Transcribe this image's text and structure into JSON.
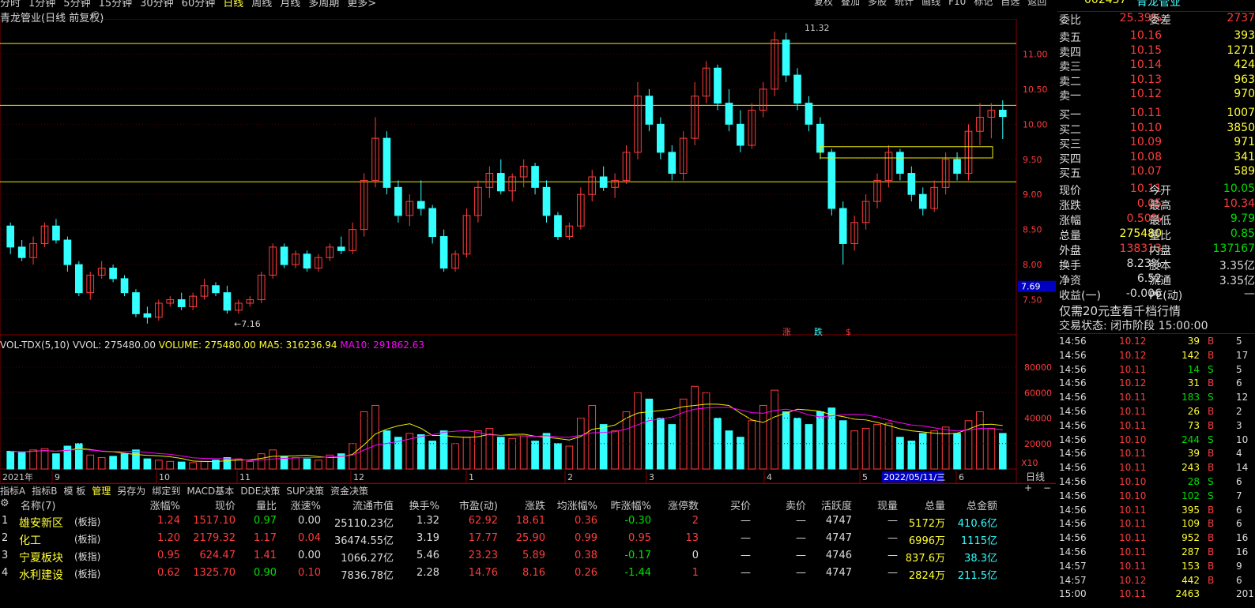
{
  "toolbar": {
    "periods": [
      "分时",
      "1分钟",
      "5分钟",
      "15分钟",
      "30分钟",
      "60分钟",
      "日线",
      "周线",
      "月线",
      "多周期",
      "更多>"
    ],
    "right": [
      "复权",
      "叠加",
      "多股",
      "统计",
      "画线",
      "F10",
      "标记",
      "自选",
      "返回"
    ]
  },
  "chart_title": "青龙管业(日线 前复权)",
  "stock_header": {
    "code": "002457",
    "name": "青龙管业"
  },
  "price_axis": {
    "ticks": [
      "11.00",
      "10.50",
      "10.00",
      "9.50",
      "9.00",
      "8.50",
      "8.00",
      "7.50"
    ],
    "last_label": "7.69"
  },
  "annotations": {
    "high": "11.32",
    "low": "7.16",
    "signals": [
      "涨",
      "跌",
      "$"
    ]
  },
  "volume_legend": {
    "name": "VOL-TDX(5,10)",
    "vvol": "VVOL: 275480.00",
    "volume": "VOLUME: 275480.00",
    "ma5": "MA5: 316236.94",
    "ma10": "MA10: 291862.63"
  },
  "volume_axis": {
    "ticks": [
      "80000",
      "60000",
      "40000",
      "20000"
    ],
    "unit": "X10"
  },
  "date_axis": {
    "labels": [
      "2021年",
      "9",
      "10",
      "11",
      "12",
      "1",
      "2",
      "3",
      "4",
      "5",
      "6"
    ],
    "cursor_date": "2022/05/11/三",
    "mode": "日线"
  },
  "bottom_tabs": [
    "指标A",
    "指标B",
    "模 板",
    "管理",
    "另存为",
    "绑定到",
    "MACD基本",
    "DDE决策",
    "SUP决策",
    "资金决策"
  ],
  "table": {
    "title": "名称(7)",
    "headers": [
      "涨幅%",
      "现价",
      "量比",
      "涨速%",
      "流通市值",
      "换手%",
      "市盈(动)",
      "涨跌",
      "均涨幅%",
      "昨涨幅%",
      "涨停数",
      "买价",
      "卖价",
      "活跃度",
      "现量",
      "总量",
      "总金额"
    ],
    "rows": [
      {
        "n": "1",
        "name": "雄安新区",
        "tag": "(板指)",
        "v": [
          "1.24",
          "1517.10",
          "0.97",
          "0.00",
          "25110.23亿",
          "1.32",
          "62.92",
          "18.61",
          "0.36",
          "-0.30",
          "2",
          "—",
          "—",
          "4747",
          "—",
          "5172万",
          "410.6亿"
        ]
      },
      {
        "n": "2",
        "name": "化工",
        "tag": "(板指)",
        "v": [
          "1.20",
          "2179.32",
          "1.17",
          "0.04",
          "36474.55亿",
          "3.19",
          "17.77",
          "25.90",
          "0.99",
          "0.95",
          "13",
          "—",
          "—",
          "4747",
          "—",
          "6996万",
          "1115亿"
        ]
      },
      {
        "n": "3",
        "name": "宁夏板块",
        "tag": "(板指)",
        "v": [
          "0.95",
          "624.47",
          "1.41",
          "0.00",
          "1066.27亿",
          "5.46",
          "23.23",
          "5.89",
          "0.38",
          "-0.17",
          "0",
          "—",
          "—",
          "4746",
          "—",
          "837.6万",
          "38.3亿"
        ]
      },
      {
        "n": "4",
        "name": "水利建设",
        "tag": "(板指)",
        "v": [
          "0.62",
          "1325.70",
          "0.90",
          "0.10",
          "7836.78亿",
          "2.28",
          "14.76",
          "8.16",
          "0.26",
          "-1.44",
          "1",
          "—",
          "—",
          "4747",
          "—",
          "2824万",
          "211.5亿"
        ]
      }
    ]
  },
  "orderbook": {
    "weibi": [
      "委比",
      "25.39%",
      "委差",
      "2737"
    ],
    "asks": [
      [
        "卖五",
        "10.16",
        "393"
      ],
      [
        "卖四",
        "10.15",
        "1271"
      ],
      [
        "卖三",
        "10.14",
        "424"
      ],
      [
        "卖二",
        "10.13",
        "963"
      ],
      [
        "卖一",
        "10.12",
        "970"
      ]
    ],
    "bids": [
      [
        "买一",
        "10.11",
        "1007"
      ],
      [
        "买二",
        "10.10",
        "3850"
      ],
      [
        "买三",
        "10.09",
        "971"
      ],
      [
        "买四",
        "10.08",
        "341"
      ],
      [
        "买五",
        "10.07",
        "589"
      ]
    ],
    "quote": [
      [
        "现价",
        "10.11",
        "今开",
        "10.05"
      ],
      [
        "涨跌",
        "0.05",
        "最高",
        "10.34"
      ],
      [
        "涨幅",
        "0.50%",
        "最低",
        "9.79"
      ],
      [
        "总量",
        "275480",
        "量比",
        "0.85"
      ],
      [
        "外盘",
        "138313",
        "内盘",
        "137167"
      ],
      [
        "换手",
        "8.23%",
        "股本",
        "3.35亿"
      ],
      [
        "净资",
        "6.52",
        "流通",
        "3.35亿"
      ],
      [
        "收益(一)",
        "-0.006",
        "PE(动)",
        "—"
      ]
    ],
    "promo": "仅需20元查看千档行情",
    "status": "交易状态: 闭市阶段 15:00:00"
  },
  "ticks": [
    [
      "14:56",
      "10.12",
      "39",
      "B",
      "5"
    ],
    [
      "14:56",
      "10.12",
      "142",
      "B",
      "17"
    ],
    [
      "14:56",
      "10.11",
      "14",
      "S",
      "5"
    ],
    [
      "14:56",
      "10.12",
      "31",
      "B",
      "6"
    ],
    [
      "14:56",
      "10.11",
      "183",
      "S",
      "12"
    ],
    [
      "14:56",
      "10.11",
      "26",
      "B",
      "2"
    ],
    [
      "14:56",
      "10.11",
      "73",
      "B",
      "3"
    ],
    [
      "14:56",
      "10.10",
      "244",
      "S",
      "10"
    ],
    [
      "14:56",
      "10.11",
      "39",
      "B",
      "4"
    ],
    [
      "14:56",
      "10.11",
      "243",
      "B",
      "14"
    ],
    [
      "14:56",
      "10.10",
      "28",
      "S",
      "6"
    ],
    [
      "14:56",
      "10.10",
      "102",
      "S",
      "7"
    ],
    [
      "14:56",
      "10.11",
      "395",
      "B",
      "6"
    ],
    [
      "14:56",
      "10.11",
      "109",
      "B",
      "6"
    ],
    [
      "14:56",
      "10.11",
      "952",
      "B",
      "16"
    ],
    [
      "14:56",
      "10.11",
      "287",
      "B",
      "16"
    ],
    [
      "14:57",
      "10.11",
      "153",
      "B",
      "9"
    ],
    [
      "14:57",
      "10.12",
      "442",
      "B",
      "6"
    ],
    [
      "15:00",
      "10.11",
      "2463",
      "",
      "201"
    ]
  ],
  "chart_data": {
    "type": "candlestick",
    "title": "青龙管业(日线 前复权)",
    "y_range": [
      7.0,
      11.5
    ],
    "volume_range": [
      0,
      90000
    ],
    "horizontal_lines": [
      11.15,
      10.27,
      9.18
    ],
    "ohlc": [
      [
        8.55,
        8.6,
        8.15,
        8.25
      ],
      [
        8.25,
        8.35,
        8.05,
        8.1
      ],
      [
        8.1,
        8.4,
        8.0,
        8.3
      ],
      [
        8.3,
        8.6,
        8.25,
        8.55
      ],
      [
        8.55,
        8.65,
        8.3,
        8.35
      ],
      [
        8.35,
        8.4,
        7.9,
        8.0
      ],
      [
        8.0,
        8.05,
        7.55,
        7.6
      ],
      [
        7.6,
        7.9,
        7.5,
        7.85
      ],
      [
        7.85,
        8.05,
        7.8,
        7.95
      ],
      [
        7.95,
        8.0,
        7.75,
        7.8
      ],
      [
        7.8,
        7.85,
        7.55,
        7.6
      ],
      [
        7.6,
        7.65,
        7.25,
        7.3
      ],
      [
        7.3,
        7.4,
        7.16,
        7.25
      ],
      [
        7.25,
        7.5,
        7.2,
        7.45
      ],
      [
        7.45,
        7.55,
        7.4,
        7.5
      ],
      [
        7.5,
        7.6,
        7.35,
        7.4
      ],
      [
        7.4,
        7.6,
        7.35,
        7.55
      ],
      [
        7.55,
        7.8,
        7.5,
        7.7
      ],
      [
        7.7,
        7.75,
        7.55,
        7.6
      ],
      [
        7.6,
        7.7,
        7.3,
        7.35
      ],
      [
        7.35,
        7.5,
        7.3,
        7.45
      ],
      [
        7.45,
        7.55,
        7.4,
        7.5
      ],
      [
        7.5,
        7.9,
        7.45,
        7.85
      ],
      [
        7.85,
        8.3,
        7.8,
        8.25
      ],
      [
        8.25,
        8.3,
        7.95,
        8.0
      ],
      [
        8.0,
        8.2,
        7.95,
        8.15
      ],
      [
        8.15,
        8.2,
        7.9,
        7.95
      ],
      [
        7.95,
        8.15,
        7.9,
        8.1
      ],
      [
        8.1,
        8.3,
        8.05,
        8.25
      ],
      [
        8.25,
        8.4,
        8.15,
        8.2
      ],
      [
        8.2,
        8.6,
        8.15,
        8.5
      ],
      [
        8.5,
        9.3,
        8.4,
        9.2
      ],
      [
        9.2,
        10.1,
        9.1,
        9.8
      ],
      [
        9.8,
        9.9,
        9.0,
        9.1
      ],
      [
        9.1,
        9.2,
        8.6,
        8.7
      ],
      [
        8.7,
        9.0,
        8.55,
        8.9
      ],
      [
        8.9,
        9.2,
        8.7,
        8.8
      ],
      [
        8.8,
        8.85,
        8.3,
        8.4
      ],
      [
        8.4,
        8.5,
        7.9,
        7.95
      ],
      [
        7.95,
        8.2,
        7.9,
        8.15
      ],
      [
        8.15,
        8.8,
        8.1,
        8.7
      ],
      [
        8.7,
        9.2,
        8.6,
        9.1
      ],
      [
        9.1,
        9.4,
        8.95,
        9.3
      ],
      [
        9.3,
        9.5,
        9.0,
        9.05
      ],
      [
        9.05,
        9.3,
        8.9,
        9.25
      ],
      [
        9.25,
        9.5,
        9.1,
        9.4
      ],
      [
        9.4,
        9.45,
        9.0,
        9.1
      ],
      [
        9.1,
        9.2,
        8.6,
        8.7
      ],
      [
        8.7,
        8.75,
        8.35,
        8.4
      ],
      [
        8.4,
        8.6,
        8.35,
        8.55
      ],
      [
        8.55,
        9.1,
        8.5,
        9.0
      ],
      [
        9.0,
        9.35,
        8.9,
        9.25
      ],
      [
        9.25,
        9.4,
        9.05,
        9.1
      ],
      [
        9.1,
        9.3,
        8.95,
        9.2
      ],
      [
        9.2,
        9.7,
        9.15,
        9.6
      ],
      [
        9.6,
        10.6,
        9.5,
        10.4
      ],
      [
        10.4,
        10.5,
        9.9,
        10.0
      ],
      [
        10.0,
        10.1,
        9.5,
        9.6
      ],
      [
        9.6,
        9.7,
        9.2,
        9.3
      ],
      [
        9.3,
        9.9,
        9.2,
        9.8
      ],
      [
        9.8,
        10.6,
        9.7,
        10.4
      ],
      [
        10.4,
        10.9,
        10.3,
        10.8
      ],
      [
        10.8,
        10.85,
        10.2,
        10.3
      ],
      [
        10.3,
        10.5,
        9.9,
        10.0
      ],
      [
        10.0,
        10.2,
        9.6,
        9.7
      ],
      [
        9.7,
        10.3,
        9.65,
        10.2
      ],
      [
        10.2,
        10.6,
        10.1,
        10.5
      ],
      [
        10.5,
        11.32,
        10.4,
        11.2
      ],
      [
        11.2,
        11.3,
        10.6,
        10.7
      ],
      [
        10.7,
        10.8,
        10.2,
        10.3
      ],
      [
        10.3,
        10.4,
        9.9,
        10.0
      ],
      [
        10.0,
        10.1,
        9.5,
        9.6
      ],
      [
        9.6,
        9.65,
        8.7,
        8.8
      ],
      [
        8.8,
        8.9,
        8.0,
        8.3
      ],
      [
        8.3,
        8.7,
        8.2,
        8.6
      ],
      [
        8.6,
        9.0,
        8.5,
        8.9
      ],
      [
        8.9,
        9.3,
        8.8,
        9.2
      ],
      [
        9.2,
        9.7,
        9.1,
        9.6
      ],
      [
        9.6,
        9.65,
        9.2,
        9.3
      ],
      [
        9.3,
        9.4,
        8.9,
        9.0
      ],
      [
        9.0,
        9.1,
        8.7,
        8.8
      ],
      [
        8.8,
        9.2,
        8.75,
        9.1
      ],
      [
        9.1,
        9.6,
        9.0,
        9.5
      ],
      [
        9.5,
        9.6,
        9.2,
        9.3
      ],
      [
        9.3,
        10.0,
        9.2,
        9.9
      ],
      [
        9.9,
        10.3,
        9.7,
        10.1
      ],
      [
        10.1,
        10.3,
        9.8,
        10.2
      ],
      [
        10.2,
        10.34,
        9.79,
        10.11
      ]
    ],
    "volume": [
      14000,
      13000,
      15000,
      16000,
      12000,
      18000,
      20000,
      11000,
      9000,
      10000,
      12000,
      15000,
      8000,
      7000,
      6000,
      5500,
      5000,
      6000,
      7000,
      9000,
      8000,
      6000,
      12000,
      15000,
      10000,
      9000,
      8000,
      7000,
      11000,
      12000,
      20000,
      45000,
      50000,
      30000,
      25000,
      28000,
      27000,
      22000,
      30000,
      20000,
      25000,
      30000,
      32000,
      25000,
      24000,
      26000,
      22000,
      28000,
      20000,
      18000,
      40000,
      50000,
      35000,
      30000,
      45000,
      60000,
      55000,
      40000,
      35000,
      55000,
      65000,
      60000,
      40000,
      30000,
      25000,
      38000,
      50000,
      62000,
      45000,
      40000,
      35000,
      45000,
      48000,
      38000,
      30000,
      32000,
      35000,
      36000,
      25000,
      22000,
      28000,
      30000,
      33000,
      28000,
      38000,
      45000,
      32000,
      28000
    ],
    "ma5_label": "MA5",
    "ma10_label": "MA10"
  }
}
